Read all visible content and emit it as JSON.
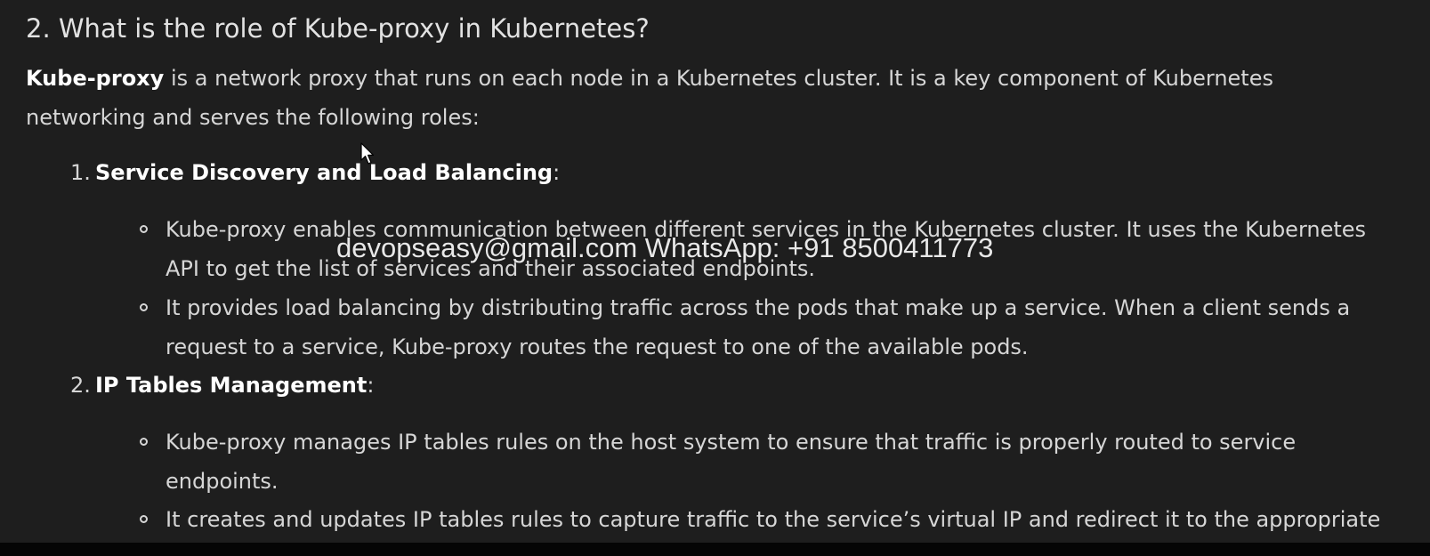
{
  "heading": "2. What is the role of Kube-proxy in Kubernetes?",
  "intro": {
    "bold": "Kube-proxy",
    "text": " is a network proxy that runs on each node in a Kubernetes cluster. It is a key component of Kubernetes networking and serves the following roles:"
  },
  "items": [
    {
      "number": "1.",
      "title": "Service Discovery and Load Balancing",
      "suffix": ":",
      "bullets": [
        "Kube-proxy enables communication between different services in the Kubernetes cluster. It uses the Kubernetes API to get the list of services and their associated endpoints.",
        "It provides load balancing by distributing traffic across the pods that make up a service. When a client sends a request to a service, Kube-proxy routes the request to one of the available pods."
      ]
    },
    {
      "number": "2.",
      "title": "IP Tables Management",
      "suffix": ":",
      "bullets": [
        "Kube-proxy manages IP tables rules on the host system to ensure that traffic is properly routed to service endpoints.",
        "It creates and updates IP tables rules to capture traffic to the service’s virtual IP and redirect it to the appropriate"
      ]
    }
  ],
  "watermark": "devopseasy@gmail.com WhatsApp: +91 8500411773",
  "colors": {
    "background": "#1e1e1e",
    "text": "#d6d6d6",
    "bold": "#ffffff",
    "bottom_bar": "#050505"
  },
  "icons": {
    "cursor": "mouse-pointer-icon",
    "bullet": "hollow-circle-bullet-icon"
  }
}
